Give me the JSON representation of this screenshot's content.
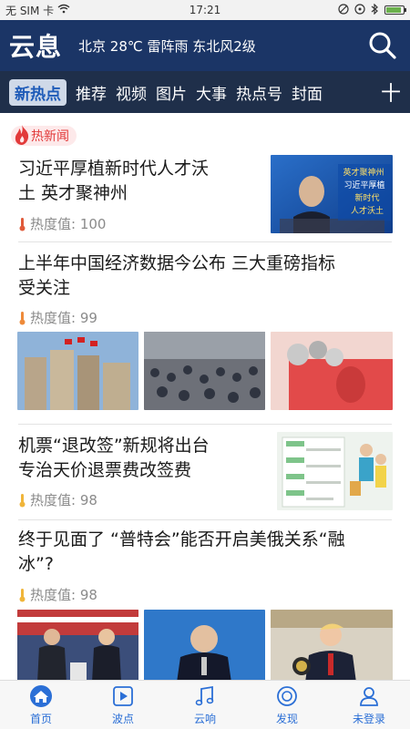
{
  "status_bar": {
    "carrier": "无 SIM 卡",
    "time": "17:21",
    "battery_percent": 90
  },
  "header": {
    "logo": "云息",
    "weather": "北京 28℃ 雷阵雨 东北风2级"
  },
  "tabs": [
    {
      "label": "新热点",
      "active": true
    },
    {
      "label": "推荐"
    },
    {
      "label": "视频"
    },
    {
      "label": "图片"
    },
    {
      "label": "大事"
    },
    {
      "label": "热点号"
    },
    {
      "label": "封面"
    },
    {
      "label": "十"
    }
  ],
  "section": {
    "label": "热新闻"
  },
  "articles": [
    {
      "title_line1": "习近平厚植新时代人才沃",
      "title_line2": "土 英才聚神州",
      "heat": "热度值: 100",
      "thumb_text": [
        "英才聚神州",
        "习近平厚植",
        "新时代",
        "人才沃土"
      ]
    },
    {
      "title_line1": "上半年中国经济数据今公布 三大重磅指标",
      "title_line2": "受关注",
      "heat": "热度值: 99"
    },
    {
      "title_line1": "机票“退改签”新规将出台",
      "title_line2": "专治天价退票费改签费",
      "heat": "热度值: 98"
    },
    {
      "title_line1": "终于见面了 “普特会”能否开启美俄关系“融",
      "title_line2": "冰”?",
      "heat": "热度值: 98"
    }
  ],
  "bottom_nav": [
    {
      "label": "首页",
      "icon": "home-icon",
      "active": true
    },
    {
      "label": "波点",
      "icon": "video-icon"
    },
    {
      "label": "云响",
      "icon": "music-icon"
    },
    {
      "label": "发现",
      "icon": "discover-icon"
    },
    {
      "label": "未登录",
      "icon": "user-icon"
    }
  ],
  "colors": {
    "header_bg": "#1b3566",
    "tabs_bg": "#1f2f4a",
    "accent_blue": "#2b6fd6",
    "tag_red": "#e23a3a"
  }
}
